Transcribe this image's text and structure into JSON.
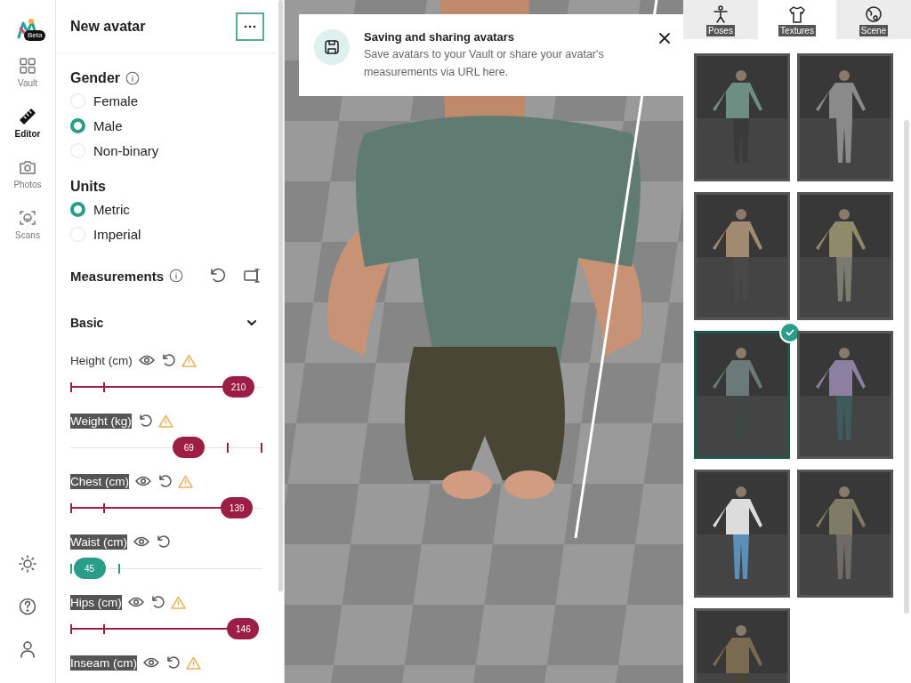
{
  "rail": {
    "badge": "Beta",
    "items": [
      {
        "label": "Vault",
        "selected": false
      },
      {
        "label": "Editor",
        "selected": true
      },
      {
        "label": "Photos",
        "selected": false
      },
      {
        "label": "Scans",
        "selected": false
      }
    ]
  },
  "panel": {
    "title": "New avatar",
    "gender": {
      "heading": "Gender",
      "options": [
        {
          "label": "Female",
          "selected": false
        },
        {
          "label": "Male",
          "selected": true
        },
        {
          "label": "Non-binary",
          "selected": false
        }
      ]
    },
    "units": {
      "heading": "Units",
      "options": [
        {
          "label": "Metric",
          "selected": true
        },
        {
          "label": "Imperial",
          "selected": false
        }
      ]
    },
    "measurements": {
      "heading": "Measurements",
      "group": {
        "title": "Basic",
        "expanded": true
      },
      "items": [
        {
          "label": "Height (cm)",
          "highlighted": false,
          "eye": true,
          "warning": true,
          "level": 0.95,
          "reading": "210",
          "color": "#9c1d46",
          "filled": true
        },
        {
          "label": "Weight (kg)",
          "highlighted": true,
          "eye": false,
          "warning": true,
          "level": 0.64,
          "reading": "69",
          "color": "#9c1d46",
          "filled": false
        },
        {
          "label": "Chest (cm)",
          "highlighted": true,
          "eye": true,
          "warning": true,
          "level": 0.94,
          "reading": "139",
          "color": "#9c1d46",
          "filled": true
        },
        {
          "label": "Waist (cm)",
          "highlighted": true,
          "eye": true,
          "warning": false,
          "level": 0.02,
          "reading": "45",
          "color": "#2a9d88",
          "filled": false
        },
        {
          "label": "Hips (cm)",
          "highlighted": true,
          "eye": true,
          "warning": true,
          "level": 0.98,
          "reading": "146",
          "color": "#9c1d46",
          "filled": true
        },
        {
          "label": "Inseam (cm)",
          "highlighted": true,
          "eye": true,
          "warning": true
        }
      ]
    }
  },
  "toast": {
    "title": "Saving and sharing avatars",
    "text": "Save avatars to your Vault or share your avatar's measurements via URL here."
  },
  "library": {
    "tabs": [
      {
        "label": "Poses",
        "selected": false,
        "highlighted": true
      },
      {
        "label": "Textures",
        "selected": true,
        "highlighted": true
      },
      {
        "label": "Scene",
        "selected": false,
        "highlighted": true
      }
    ],
    "textures": [
      {
        "kind": "picture",
        "selected": false
      },
      {
        "kind": "picture",
        "selected": false
      },
      {
        "kind": "picture",
        "selected": false
      },
      {
        "kind": "picture",
        "selected": false
      },
      {
        "kind": "picture",
        "selected": true
      },
      {
        "kind": "picture",
        "selected": false
      },
      {
        "kind": "picture",
        "selected": false
      },
      {
        "kind": "picture",
        "selected": false
      },
      {
        "kind": "picture",
        "selected": false
      }
    ]
  }
}
